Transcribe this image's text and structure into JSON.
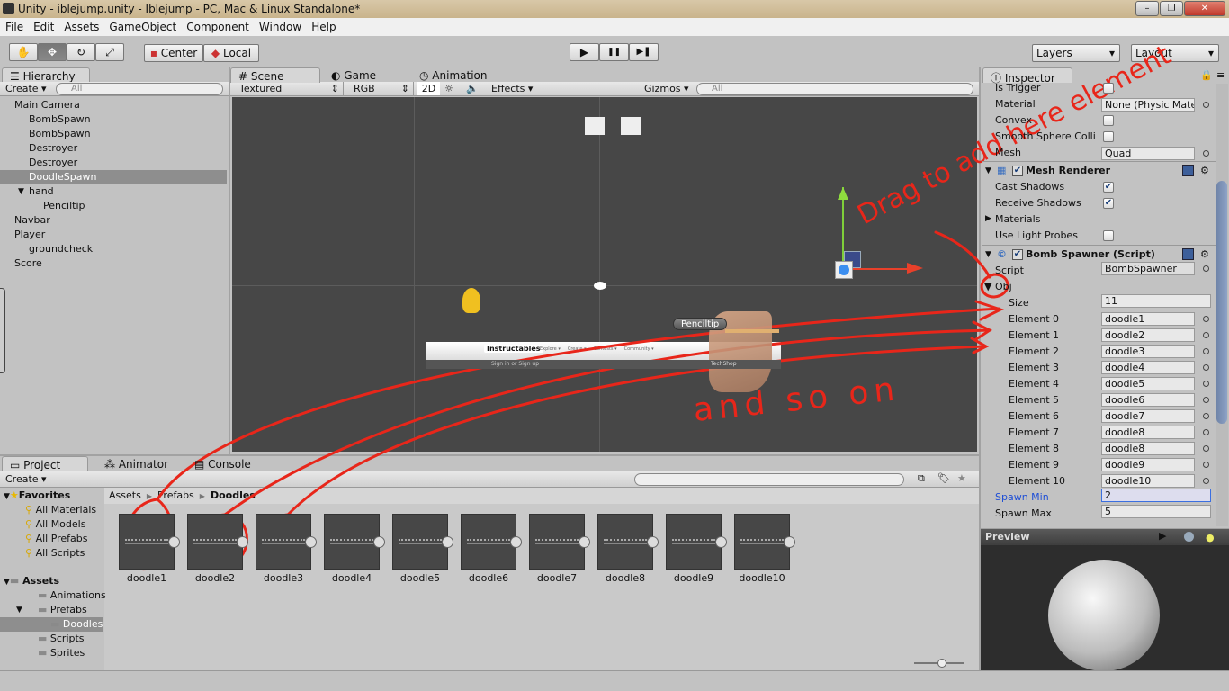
{
  "window": {
    "title": "Unity - iblejump.unity - Iblejump - PC, Mac & Linux Standalone*",
    "minimize": "–",
    "maximize": "❐",
    "close": "✕"
  },
  "menu": [
    "File",
    "Edit",
    "Assets",
    "GameObject",
    "Component",
    "Window",
    "Help"
  ],
  "toolbar": {
    "tools": [
      "hand-tool",
      "move-tool",
      "rotate-tool",
      "scale-tool"
    ],
    "pivot": "Center",
    "space": "Local",
    "play": "▶",
    "pause": "❚❚",
    "step": "▶❚",
    "layers": "Layers",
    "layout": "Layout"
  },
  "hierarchy": {
    "tab": "Hierarchy",
    "create": "Create",
    "search_placeholder": "All",
    "items": [
      {
        "label": "Main Camera",
        "level": 0
      },
      {
        "label": "BombSpawn",
        "level": 1
      },
      {
        "label": "BombSpawn",
        "level": 1
      },
      {
        "label": "Destroyer",
        "level": 1
      },
      {
        "label": "Destroyer",
        "level": 1
      },
      {
        "label": "DoodleSpawn",
        "level": 1,
        "selected": true
      },
      {
        "label": "hand",
        "level": 1,
        "expanded": true
      },
      {
        "label": "Penciltip",
        "level": 2
      },
      {
        "label": "Navbar",
        "level": 0
      },
      {
        "label": "Player",
        "level": 0
      },
      {
        "label": "groundcheck",
        "level": 1
      },
      {
        "label": "Score",
        "level": 0
      }
    ]
  },
  "scene": {
    "tabs": [
      "Scene",
      "Game",
      "Animation"
    ],
    "render_mode": "Textured",
    "color_mode": "RGB",
    "mode_2d": "2D",
    "effects": "Effects",
    "gizmos": "Gizmos",
    "search_placeholder": "All",
    "navbar_brand": "Instructables",
    "navbar_menus": [
      "Explore ▾",
      "Create ▾",
      "Contests ▾",
      "Community ▾"
    ],
    "navbar_sub": "Sign in or Sign up",
    "navbar_right": "TechShop",
    "penciltip_label": "Penciltip"
  },
  "inspector": {
    "tab": "Inspector",
    "collider_rows": [
      {
        "label": "Is Trigger",
        "type": "check",
        "checked": false
      },
      {
        "label": "Material",
        "type": "field",
        "value": "None (Physic Mate"
      },
      {
        "label": "Convex",
        "type": "check",
        "checked": false
      },
      {
        "label": "Smooth Sphere Colli",
        "type": "check",
        "checked": false
      },
      {
        "label": "Mesh",
        "type": "field",
        "value": "Quad"
      }
    ],
    "mesh_renderer": {
      "title": "Mesh Renderer",
      "rows": [
        {
          "label": "Cast Shadows",
          "type": "check",
          "checked": true
        },
        {
          "label": "Receive Shadows",
          "type": "check",
          "checked": true
        },
        {
          "label": "Materials",
          "type": "fold"
        },
        {
          "label": "Use Light Probes",
          "type": "check",
          "checked": false
        }
      ]
    },
    "bomb_spawner": {
      "title": "Bomb Spawner (Script)",
      "script_label": "Script",
      "script_value": "BombSpawner",
      "array_label": "Obj",
      "size_label": "Size",
      "size_value": "11",
      "elements": [
        {
          "label": "Element 0",
          "value": "doodle1"
        },
        {
          "label": "Element 1",
          "value": "doodle2"
        },
        {
          "label": "Element 2",
          "value": "doodle3"
        },
        {
          "label": "Element 3",
          "value": "doodle4"
        },
        {
          "label": "Element 4",
          "value": "doodle5"
        },
        {
          "label": "Element 5",
          "value": "doodle6"
        },
        {
          "label": "Element 6",
          "value": "doodle7"
        },
        {
          "label": "Element 7",
          "value": "doodle8"
        },
        {
          "label": "Element 8",
          "value": "doodle8"
        },
        {
          "label": "Element 9",
          "value": "doodle9"
        },
        {
          "label": "Element 10",
          "value": "doodle10"
        }
      ],
      "spawn_min_label": "Spawn Min",
      "spawn_min": "2",
      "spawn_max_label": "Spawn Max",
      "spawn_max": "5"
    },
    "preview": "Preview"
  },
  "project": {
    "tabs": [
      "Project",
      "Animator",
      "Console"
    ],
    "create": "Create",
    "favorites": {
      "label": "Favorites",
      "items": [
        "All Materials",
        "All Models",
        "All Prefabs",
        "All Scripts"
      ]
    },
    "assets": {
      "label": "Assets",
      "items": [
        {
          "label": "Animations",
          "level": 1
        },
        {
          "label": "Prefabs",
          "level": 1
        },
        {
          "label": "Doodles",
          "level": 2,
          "selected": true
        },
        {
          "label": "Scripts",
          "level": 1
        },
        {
          "label": "Sprites",
          "level": 1
        }
      ]
    },
    "breadcrumb": [
      "Assets",
      "Prefabs",
      "Doodles"
    ],
    "assets_grid": [
      "doodle1",
      "doodle2",
      "doodle3",
      "doodle4",
      "doodle5",
      "doodle6",
      "doodle7",
      "doodle8",
      "doodle9",
      "doodle10"
    ]
  },
  "annotations": {
    "drag": "Drag to add here element",
    "so_on": "and so on",
    "color": "#e8261a"
  },
  "colors": {
    "panel": "#c2c2c2",
    "scene_bg": "#474747",
    "selection": "#8e8e8e",
    "highlight_label": "#1f4fd6"
  }
}
